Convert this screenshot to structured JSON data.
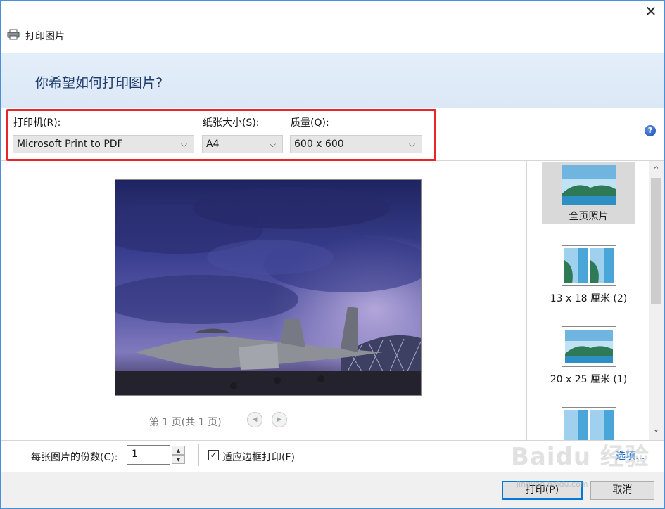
{
  "window": {
    "close_glyph": "✕",
    "title": "打印图片"
  },
  "banner": {
    "question": "你希望如何打印图片?"
  },
  "controls": {
    "printer_label": "打印机(R):",
    "printer_value": "Microsoft Print to PDF",
    "paper_label": "纸张大小(S):",
    "paper_value": "A4",
    "quality_label": "质量(Q):",
    "quality_value": "600 x 600",
    "help_glyph": "?",
    "dropdown_glyph": "⌵"
  },
  "preview": {
    "page_info": "第 1 页(共 1 页)",
    "prev_glyph": "◀",
    "next_glyph": "▶"
  },
  "layouts": [
    {
      "label": "全页照片",
      "selected": true
    },
    {
      "label": "13 x 18 厘米 (2)",
      "selected": false
    },
    {
      "label": "20 x 25 厘米 (1)",
      "selected": false
    },
    {
      "label": "",
      "selected": false
    }
  ],
  "scrollbar": {
    "up_glyph": "⌃",
    "down_glyph": "⌄"
  },
  "options": {
    "copies_label": "每张图片的份数(C):",
    "copies_value": "1",
    "spin_up": "▲",
    "spin_down": "▼",
    "fit_label": "适应边框打印(F)",
    "fit_checked": true,
    "check_glyph": "✓",
    "options_link": "选项..."
  },
  "buttons": {
    "print": "打印(P)",
    "cancel": "取消"
  },
  "watermark": {
    "text": "Baidu 经验",
    "sub": "jingyan.baidu.com"
  },
  "colors": {
    "highlight": "#e8262a",
    "banner_text": "#1e3b6a",
    "link": "#0066cc",
    "primary_border": "#0078d7"
  }
}
